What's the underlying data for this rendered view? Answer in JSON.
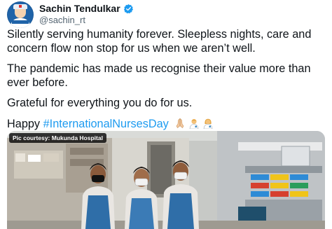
{
  "tweet": {
    "author": {
      "display_name": "Sachin Tendulkar",
      "handle": "@sachin_rt",
      "verified": true,
      "avatar_icon": "nurse-avatar-icon"
    },
    "paragraphs": [
      "Silently serving humanity forever. Sleepless nights, care and concern flow non stop for us when we aren’t well.",
      "The pandemic has made us recognise their value more than ever before.",
      "Grateful for everything you do for us."
    ],
    "closing": {
      "prefix": "Happy",
      "hashtag": "#InternationalNursesDay",
      "emojis": [
        "folded-hands-icon",
        "health-worker-man-icon",
        "health-worker-woman-icon"
      ]
    },
    "media": {
      "courtesy": "Pic courtesy: Mukunda Hospital",
      "description_icon": "nurses-photo"
    },
    "colors": {
      "link": "#1d9bf0",
      "verified": "#1d9bf0",
      "secondary_text": "#536471"
    }
  }
}
